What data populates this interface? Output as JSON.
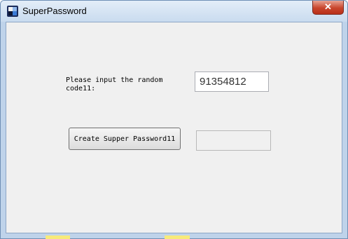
{
  "window": {
    "title": "SuperPassword",
    "close_symbol": "✕"
  },
  "form": {
    "prompt": "Please input the random code11:",
    "code_value": "91354812",
    "create_label": "Create Supper Password11",
    "result_value": ""
  },
  "icons": {
    "app": "app-logo-icon",
    "close": "close-icon"
  }
}
